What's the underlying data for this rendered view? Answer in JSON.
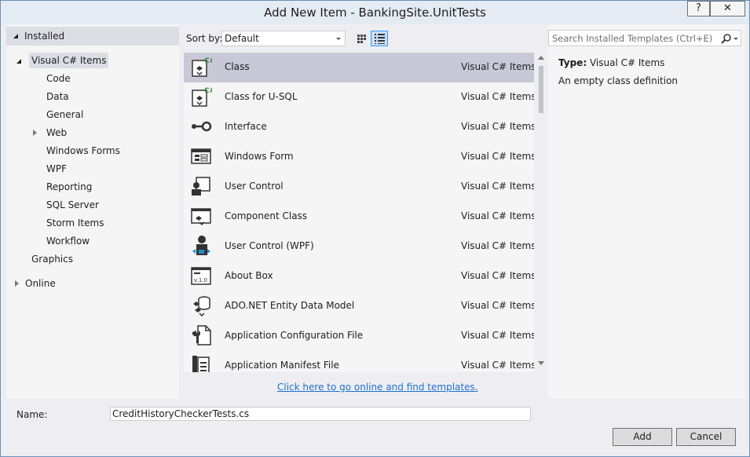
{
  "window": {
    "title": "Add New Item - BankingSite.UnitTests",
    "help_label": "?",
    "close_label": "✕"
  },
  "tree": {
    "installed": "Installed",
    "root": "Visual C# Items",
    "children": [
      "Code",
      "Data",
      "General",
      "Web",
      "Windows Forms",
      "WPF",
      "Reporting",
      "SQL Server",
      "Storm Items",
      "Workflow"
    ],
    "graphics": "Graphics",
    "online": "Online"
  },
  "toolbar": {
    "sort_label": "Sort by:",
    "sort_value": "Default"
  },
  "items": [
    {
      "name": "Class",
      "category": "Visual C# Items",
      "icon": "class-icon"
    },
    {
      "name": "Class for U-SQL",
      "category": "Visual C# Items",
      "icon": "class-usql-icon"
    },
    {
      "name": "Interface",
      "category": "Visual C# Items",
      "icon": "interface-icon"
    },
    {
      "name": "Windows Form",
      "category": "Visual C# Items",
      "icon": "windows-form-icon"
    },
    {
      "name": "User Control",
      "category": "Visual C# Items",
      "icon": "user-control-icon"
    },
    {
      "name": "Component Class",
      "category": "Visual C# Items",
      "icon": "component-class-icon"
    },
    {
      "name": "User Control (WPF)",
      "category": "Visual C# Items",
      "icon": "user-control-wpf-icon"
    },
    {
      "name": "About Box",
      "category": "Visual C# Items",
      "icon": "about-box-icon"
    },
    {
      "name": "ADO.NET Entity Data Model",
      "category": "Visual C# Items",
      "icon": "entity-data-model-icon"
    },
    {
      "name": "Application Configuration File",
      "category": "Visual C# Items",
      "icon": "config-file-icon"
    },
    {
      "name": "Application Manifest File",
      "category": "Visual C# Items",
      "icon": "manifest-file-icon"
    }
  ],
  "online_link": "Click here to go online and find templates.",
  "details": {
    "search_placeholder": "Search Installed Templates (Ctrl+E)",
    "type_label": "Type:",
    "type_value": "Visual C# Items",
    "description": "An empty class definition"
  },
  "footer": {
    "name_label": "Name:",
    "name_value": "CreditHistoryCheckerTests.cs",
    "add_label": "Add",
    "cancel_label": "Cancel"
  },
  "colors": {
    "selection": "#c8c8d6",
    "link": "#1e70cd",
    "csharp_badge": "#3a8a3a"
  }
}
